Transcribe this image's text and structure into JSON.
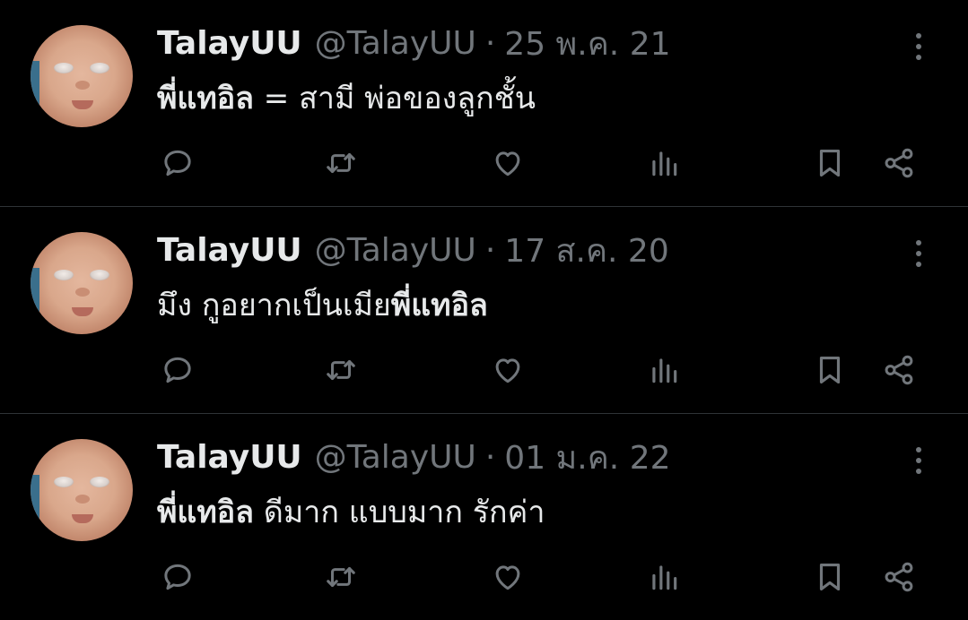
{
  "tweets": [
    {
      "author": "TalayUU",
      "handle": "@TalayUU",
      "separator": "·",
      "date": "25 พ.ค. 21",
      "text_bold": "พี่แทอิล",
      "text_rest": " = สามี พ่อของลูกชั้น"
    },
    {
      "author": "TalayUU",
      "handle": "@TalayUU",
      "separator": "·",
      "date": "17 ส.ค. 20",
      "text_rest": "มึง กูอยากเป็นเมีย",
      "text_bold": "พี่แทอิล"
    },
    {
      "author": "TalayUU",
      "handle": "@TalayUU",
      "separator": "·",
      "date": "01 ม.ค. 22",
      "text_bold": "พี่แทอิล",
      "text_rest": " ดีมาก แบบมาก รักค่า"
    }
  ],
  "icons": {
    "reply": "reply-icon",
    "retweet": "retweet-icon",
    "like": "like-icon",
    "views": "views-icon",
    "bookmark": "bookmark-icon",
    "share": "share-icon",
    "more": "more-icon"
  },
  "colors": {
    "background": "#000000",
    "text": "#e7e9ea",
    "secondary": "#71767b",
    "divider": "#2f3336"
  }
}
